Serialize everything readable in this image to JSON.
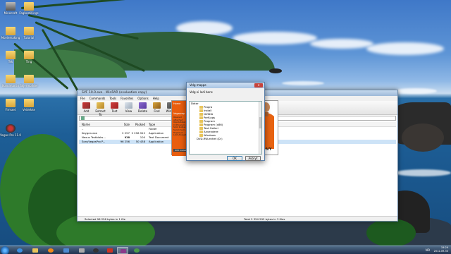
{
  "desktop": {
    "icons": [
      {
        "label": "Minecraft",
        "type": "app"
      },
      {
        "label": "Fagbestillings",
        "type": "folder"
      },
      {
        "label": "Moviemaking",
        "type": "folder"
      },
      {
        "label": "Tutorial",
        "type": "folder"
      },
      {
        "label": "Tek",
        "type": "folder"
      },
      {
        "label": "Ting",
        "type": "folder"
      },
      {
        "label": "Nandmartin",
        "type": "folder"
      },
      {
        "label": "Skjermbilder",
        "type": "folder"
      },
      {
        "label": "Firmaet",
        "type": "folder"
      },
      {
        "label": "Veidekke",
        "type": "folder"
      },
      {
        "label": "Vegas Pro 11.0",
        "type": "vegas"
      }
    ]
  },
  "winrar": {
    "title": "SVF 10.0.exe - WinRAR (evaluation copy)",
    "menu": [
      "File",
      "Commands",
      "Tools",
      "Favorites",
      "Options",
      "Help"
    ],
    "toolbar": [
      "Add",
      "Extract To",
      "Test",
      "View",
      "Delete",
      "Find",
      "Wizard"
    ],
    "columns": {
      "name": "Name",
      "size": "Size",
      "packed": "Packed",
      "type": "Type"
    },
    "rows": [
      {
        "name": "..",
        "size": "",
        "packed": "",
        "type": "Folder"
      },
      {
        "name": "Keygen.exe",
        "size": "2 257 920",
        "packed": "2 296 912",
        "type": "Application"
      },
      {
        "name": "Nexus Testbloks...",
        "size": "116",
        "packed": "100",
        "type": "Text Document"
      },
      {
        "name": "SonyVegasPro P...",
        "size": "96 256",
        "packed": "50 438",
        "type": "Application"
      }
    ],
    "status_left": "Selected 96 256 bytes in 1 file",
    "status_right": "Total 2 354 292 bytes in 3 files"
  },
  "vegas_installer": {
    "tabs": [
      "Home",
      "Vegasrep"
    ],
    "text": "Opened attached Oppdatatet av C:\\Program... Shot bulder... Send mum... * Regkeyer ... Lokt-Aliased...",
    "brand": "SONY",
    "footer": "SVD Install wizard"
  },
  "dialog": {
    "title": "Velg mappe",
    "prompt": "Velg ei ledi bens",
    "root": "Datar",
    "folders": [
      "Progra",
      "Install",
      "NVIDIA",
      "PerfLogs",
      "Program",
      "Program (x86)",
      "Test Galleri",
      "Anvendere",
      "Windows"
    ],
    "drive": "DVD-RW-enhet (D:)",
    "ok": "OK",
    "cancel": "Avbryt"
  },
  "taskbar": {
    "apps": [
      {
        "name": "ie-icon",
        "color": "#3b8fe0"
      },
      {
        "name": "explorer-icon",
        "color": "#e8c45a"
      },
      {
        "name": "media-player-icon",
        "color": "#f08a1a"
      },
      {
        "name": "mail-icon",
        "color": "#4d8ad0"
      },
      {
        "name": "settings-icon",
        "color": "#aaaaaa"
      },
      {
        "name": "steam-icon",
        "color": "#333333"
      },
      {
        "name": "vegas-icon",
        "color": "#cc3322"
      },
      {
        "name": "winrar-icon",
        "color": "#8a3b8a"
      },
      {
        "name": "chrome-icon",
        "color": "#4a9a4a"
      }
    ],
    "language": "NO",
    "time": "19:29",
    "date": "2012-09-30"
  }
}
